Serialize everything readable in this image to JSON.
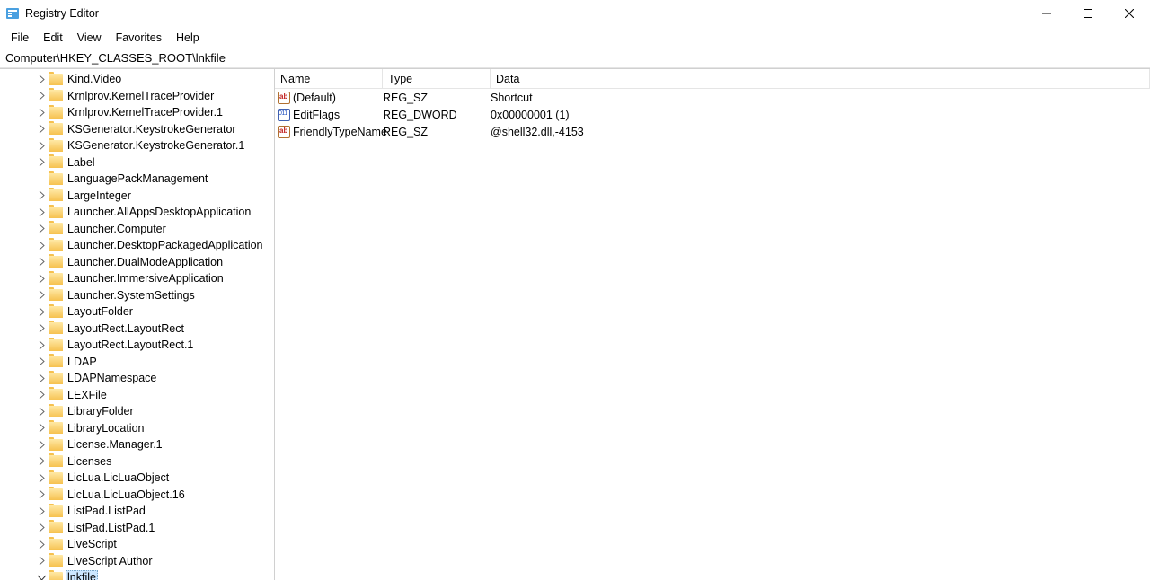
{
  "window": {
    "title": "Registry Editor"
  },
  "menu": {
    "file": "File",
    "edit": "Edit",
    "view": "View",
    "favorites": "Favorites",
    "help": "Help"
  },
  "address": "Computer\\HKEY_CLASSES_ROOT\\lnkfile",
  "tree": {
    "items": [
      {
        "label": "Kind.Video",
        "expandable": true
      },
      {
        "label": "Krnlprov.KernelTraceProvider",
        "expandable": true
      },
      {
        "label": "Krnlprov.KernelTraceProvider.1",
        "expandable": true
      },
      {
        "label": "KSGenerator.KeystrokeGenerator",
        "expandable": true
      },
      {
        "label": "KSGenerator.KeystrokeGenerator.1",
        "expandable": true
      },
      {
        "label": "Label",
        "expandable": true
      },
      {
        "label": "LanguagePackManagement",
        "expandable": false
      },
      {
        "label": "LargeInteger",
        "expandable": true
      },
      {
        "label": "Launcher.AllAppsDesktopApplication",
        "expandable": true
      },
      {
        "label": "Launcher.Computer",
        "expandable": true
      },
      {
        "label": "Launcher.DesktopPackagedApplication",
        "expandable": true
      },
      {
        "label": "Launcher.DualModeApplication",
        "expandable": true
      },
      {
        "label": "Launcher.ImmersiveApplication",
        "expandable": true
      },
      {
        "label": "Launcher.SystemSettings",
        "expandable": true
      },
      {
        "label": "LayoutFolder",
        "expandable": true
      },
      {
        "label": "LayoutRect.LayoutRect",
        "expandable": true
      },
      {
        "label": "LayoutRect.LayoutRect.1",
        "expandable": true
      },
      {
        "label": "LDAP",
        "expandable": true
      },
      {
        "label": "LDAPNamespace",
        "expandable": true
      },
      {
        "label": "LEXFile",
        "expandable": true
      },
      {
        "label": "LibraryFolder",
        "expandable": true
      },
      {
        "label": "LibraryLocation",
        "expandable": true
      },
      {
        "label": "License.Manager.1",
        "expandable": true
      },
      {
        "label": "Licenses",
        "expandable": true
      },
      {
        "label": "LicLua.LicLuaObject",
        "expandable": true
      },
      {
        "label": "LicLua.LicLuaObject.16",
        "expandable": true
      },
      {
        "label": "ListPad.ListPad",
        "expandable": true
      },
      {
        "label": "ListPad.ListPad.1",
        "expandable": true
      },
      {
        "label": "LiveScript",
        "expandable": true
      },
      {
        "label": "LiveScript Author",
        "expandable": true
      },
      {
        "label": "lnkfile",
        "expandable": true,
        "expanded": true,
        "selected": true
      }
    ]
  },
  "list": {
    "headers": {
      "name": "Name",
      "type": "Type",
      "data": "Data"
    },
    "rows": [
      {
        "icon": "sz",
        "name": "(Default)",
        "type": "REG_SZ",
        "data": "Shortcut"
      },
      {
        "icon": "dw",
        "name": "EditFlags",
        "type": "REG_DWORD",
        "data": "0x00000001 (1)"
      },
      {
        "icon": "sz",
        "name": "FriendlyTypeName",
        "type": "REG_SZ",
        "data": "@shell32.dll,-4153"
      }
    ]
  }
}
